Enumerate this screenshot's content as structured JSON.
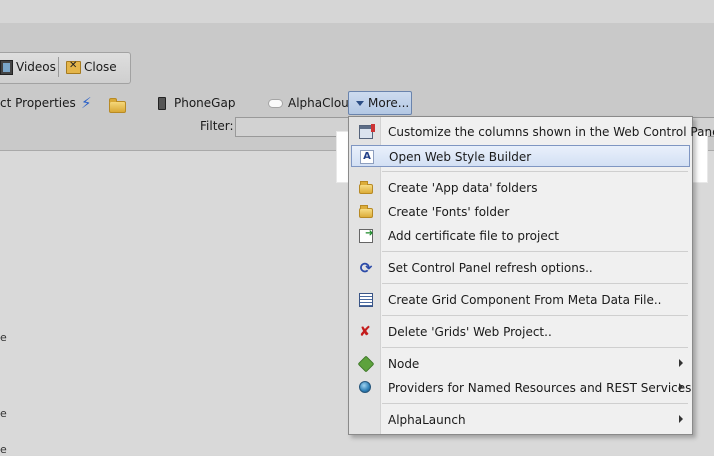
{
  "toolbar": {
    "videos_label": "Videos",
    "close_label": "Close",
    "properties_label": "ct Properties",
    "phonegap_label": "PhoneGap",
    "alphacloud_label": "AlphaCloud",
    "more_label": "More..."
  },
  "filter": {
    "label": "Filter:",
    "value": ""
  },
  "left_fragments": [
    "e",
    "e",
    "e"
  ],
  "menu": {
    "items": [
      {
        "label": "Customize the columns shown in the Web Control Panel",
        "icon": "columns-icon"
      },
      {
        "label": "Open Web Style Builder",
        "icon": "style-builder-icon",
        "selected": true
      },
      {
        "label": "Create 'App data' folders",
        "icon": "folder-icon"
      },
      {
        "label": "Create 'Fonts' folder",
        "icon": "folder-icon"
      },
      {
        "label": "Add certificate file to project",
        "icon": "certificate-icon"
      },
      {
        "label": "Set Control Panel refresh options..",
        "icon": "refresh-icon"
      },
      {
        "label": "Create Grid Component From Meta Data File..",
        "icon": "grid-icon"
      },
      {
        "label": "Delete 'Grids' Web Project..",
        "icon": "delete-icon"
      },
      {
        "label": "Node",
        "icon": "node-icon",
        "submenu": true
      },
      {
        "label": "Providers for Named Resources and REST Services",
        "icon": "globe-icon",
        "submenu": true
      },
      {
        "label": "AlphaLaunch",
        "icon": "",
        "submenu": true
      }
    ]
  }
}
